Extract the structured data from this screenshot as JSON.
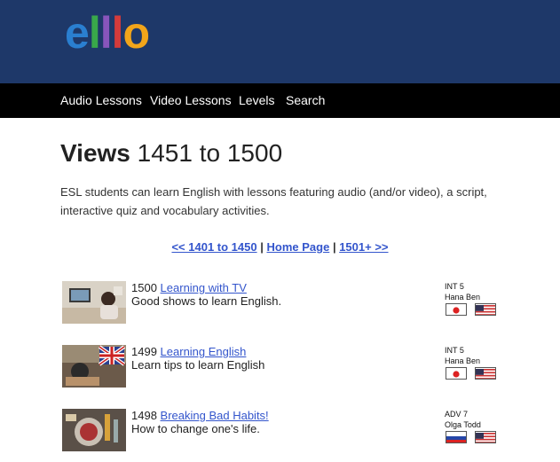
{
  "header": {
    "logo_letters": [
      "e",
      "l",
      "l",
      "l",
      "o"
    ],
    "logo_colors": [
      "#2a7fd0",
      "#39a84a",
      "#8855bb",
      "#d33b3b",
      "#f2a51a"
    ],
    "background": "#1e3869"
  },
  "nav": {
    "items": [
      {
        "label": "Audio Lessons"
      },
      {
        "label": "Video Lessons"
      },
      {
        "label": "Levels"
      },
      {
        "label": "Search"
      }
    ]
  },
  "main": {
    "title_bold": "Views",
    "title_range": "1451 to 1500",
    "intro": "ESL students can learn English with lessons featuring audio (and/or video), a script, interactive quiz and vocabulary activities.",
    "pager": {
      "prev": "<< 1401 to 1450",
      "sep1": "|",
      "home": "Home Page",
      "sep2": "|",
      "next": "1501+ >>"
    },
    "lessons": [
      {
        "number": "1500",
        "title": "Learning with TV",
        "subtitle": "Good shows to learn English.",
        "level": "INT 5",
        "speakers": "Hana Ben",
        "flags": [
          "japan-flag-icon",
          "usa-flag-icon"
        ]
      },
      {
        "number": "1499",
        "title": "Learning English",
        "subtitle": "Learn tips to learn English",
        "level": "INT 5",
        "speakers": "Hana Ben",
        "flags": [
          "japan-flag-icon",
          "usa-flag-icon"
        ]
      },
      {
        "number": "1498",
        "title": "Breaking Bad Habits!",
        "subtitle": "How to change one's life.",
        "level": "ADV 7",
        "speakers": "Olga Todd",
        "flags": [
          "russia-flag-icon",
          "usa-flag-icon"
        ]
      }
    ]
  },
  "colors": {
    "link": "#3355cc",
    "nav_bg": "#000000"
  }
}
